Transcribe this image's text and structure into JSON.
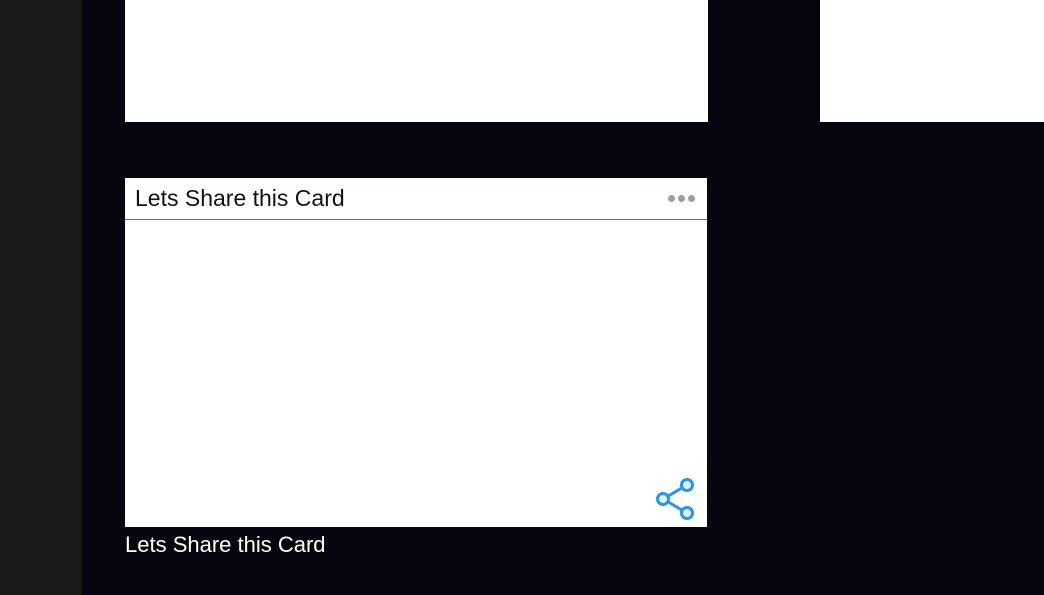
{
  "card": {
    "title": "Lets Share this Card",
    "caption": "Lets Share this Card"
  },
  "icons": {
    "more": "more-options",
    "share": "share"
  },
  "colors": {
    "accent_line": "#e53935",
    "share_icon": "#2196f3",
    "share_icon_fill": "#e3f2fd"
  }
}
